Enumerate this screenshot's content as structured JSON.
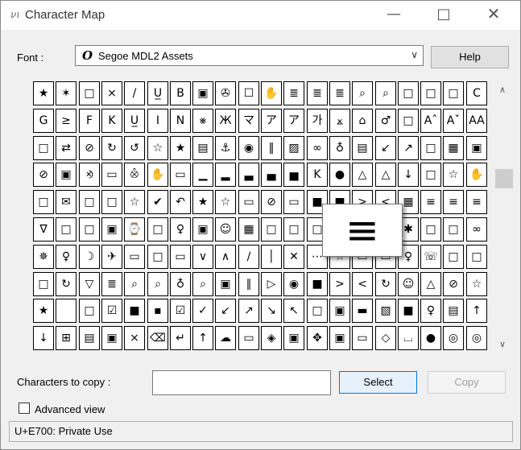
{
  "window": {
    "title": "Character Map",
    "app_icon": "νι",
    "minimize_glyph": "—",
    "maximize_glyph": "□",
    "close_glyph": "✕"
  },
  "font_selector": {
    "label": "Font :",
    "glyph": "O",
    "value": "Segoe MDL2 Assets",
    "dropdown_glyph": "∨"
  },
  "help_button": {
    "label": "Help"
  },
  "scrollbar": {
    "up_glyph": "∧",
    "down_glyph": "∨"
  },
  "character_grid": {
    "rows": [
      [
        "★",
        "✶",
        "□",
        "⨯",
        "/",
        "U̲",
        "B",
        "▣",
        "✇",
        "☐",
        "✋",
        "≣",
        "≣",
        "≣",
        "⌕",
        "⌕",
        "□",
        "□",
        "□",
        "C"
      ],
      [
        "G",
        "≥",
        "F",
        "K",
        "U̲",
        "I",
        "N",
        "⨳",
        "Ж",
        "マ",
        "ア",
        "ア",
        "가",
        "⨱",
        "⌂",
        "♂",
        "□",
        "Aˆ",
        "Aˇ",
        "AA"
      ],
      [
        "□",
        "⇄",
        "⊘",
        "↻",
        "↺",
        "☆",
        "★",
        "▤",
        "⚓",
        "◉",
        "‖",
        "▨",
        "∞",
        "♁",
        "▤",
        "↙",
        "↗",
        "□",
        "▦",
        "▣"
      ],
      [
        "⊘",
        "▣",
        "⨵",
        "▭",
        "⨶",
        "✋",
        "▭",
        "▁",
        "▂",
        "▃",
        "▄",
        "▅",
        "K",
        "●",
        "△",
        "△",
        "↓",
        "□",
        "☆",
        "✋"
      ],
      [
        "□",
        "✉",
        "□",
        "□",
        "☆",
        "✔",
        "↶",
        "★",
        "☆",
        "▭",
        "⊘",
        "▭",
        "■",
        "■",
        ">",
        "<",
        "▦",
        "≡",
        "≡",
        "≡"
      ],
      [
        "∇",
        "□",
        "□",
        "▣",
        "⌚",
        "□",
        "♀",
        "▣",
        "☺",
        "▦",
        "□",
        "□",
        "□",
        "≡",
        "□",
        "□",
        "✱",
        "□",
        "□",
        "∞"
      ],
      [
        "✵",
        "♀",
        "☽",
        "✈",
        "▭",
        "□",
        "▭",
        "∨",
        "∧",
        "∕",
        "│",
        "✕",
        "⋯",
        "☆",
        "▭",
        "▭",
        "♀",
        "☏",
        "□",
        "□"
      ],
      [
        "□",
        "↻",
        "▽",
        "≣",
        "⌕",
        "⌕",
        "♁",
        "⌕",
        "▣",
        "∥",
        "▷",
        "◉",
        "■",
        ">",
        "<",
        "↻",
        "☺",
        "△",
        "⊘",
        "☆"
      ],
      [
        "★",
        "",
        "□",
        "☑",
        "■",
        "▪",
        "☑",
        "✓",
        "↙",
        "↗",
        "↘",
        "↖",
        "□",
        "▣",
        "▬",
        "▧",
        "■",
        "♀",
        "▤",
        "↑"
      ],
      [
        "↓",
        "⊞",
        "▤",
        "▣",
        "⨯",
        "⌫",
        "↵",
        "↑",
        "☁",
        "▭",
        "◈",
        "▣",
        "✥",
        "▣",
        "▭",
        "◇",
        "⌴",
        "●",
        "◎",
        "◎"
      ]
    ],
    "selected_zoom_glyph": "≡"
  },
  "copy_section": {
    "label": "Characters to copy :",
    "input_value": "",
    "select_label": "Select",
    "copy_label": "Copy"
  },
  "advanced_view": {
    "label": "Advanced view",
    "checked": false
  },
  "status": {
    "text": "U+E700: Private Use"
  }
}
